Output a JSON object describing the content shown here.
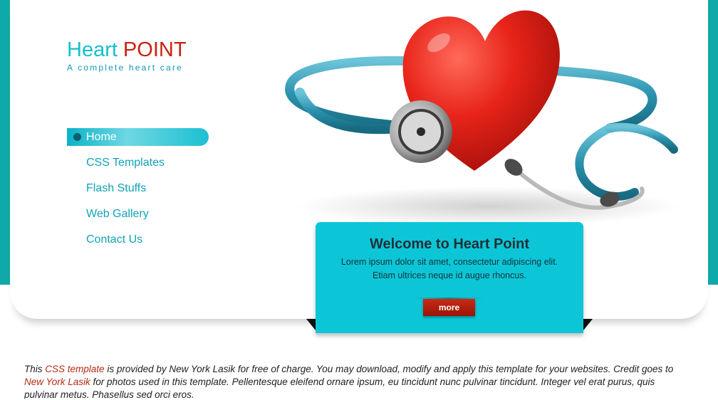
{
  "logo": {
    "title_word1": "Heart",
    "title_word2": "POINT",
    "tagline": "A complete heart care"
  },
  "nav": {
    "items": [
      {
        "label": "Home",
        "active": true
      },
      {
        "label": "CSS Templates",
        "active": false
      },
      {
        "label": "Flash Stuffs",
        "active": false
      },
      {
        "label": "Web Gallery",
        "active": false
      },
      {
        "label": "Contact Us",
        "active": false
      }
    ]
  },
  "hero": {
    "icons": [
      "heart-icon",
      "stethoscope-icon"
    ]
  },
  "welcome": {
    "title": "Welcome to Heart Point",
    "line1": "Lorem ipsum dolor sit amet, consectetur adipiscing elit.",
    "line2": "Etiam ultrices neque id augue rhoncus.",
    "more_label": "more"
  },
  "footer": {
    "t1": "This ",
    "link1": "CSS template",
    "t2": " is provided by New York Lasik for free of charge. You may download, modify and apply this template for your websites. Credit goes to ",
    "link2": "New York Lasik",
    "t3": " for photos used in this template. Pellentesque eleifend ornare ipsum, eu tincidunt nunc pulvinar tincidunt. Integer vel erat purus, quis pulvinar metus. Phasellus sed orci eros."
  },
  "colors": {
    "accent": "#13bfd1",
    "brand_red": "#c82310",
    "side_bar": "#0fa9a9",
    "welcome_bg": "#0cc6d7",
    "link": "#b32b12"
  }
}
